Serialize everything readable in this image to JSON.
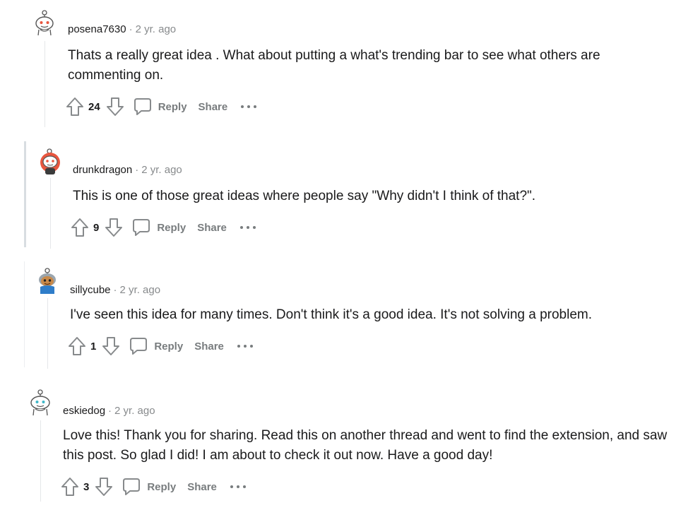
{
  "comments": [
    {
      "author": "posena7630",
      "separator": "·",
      "time": "2 yr. ago",
      "text": "Thats a really great idea . What about putting a what's trending bar to see what others are commenting on.",
      "votes": "24",
      "reply_label": "Reply",
      "share_label": "Share",
      "avatar_color": "#e8563f"
    },
    {
      "author": "drunkdragon",
      "separator": "·",
      "time": "2 yr. ago",
      "text": "This is one of those great ideas where people say \"Why didn't I think of that?\".",
      "votes": "9",
      "reply_label": "Reply",
      "share_label": "Share",
      "avatar_color": "#e8563f"
    },
    {
      "author": "sillycube",
      "separator": "·",
      "time": "2 yr. ago",
      "text": "I've seen this idea for many times. Don't think it's a good idea. It's not solving a problem.",
      "votes": "1",
      "reply_label": "Reply",
      "share_label": "Share",
      "avatar_color": "#2f7dc9"
    },
    {
      "author": "eskiedog",
      "separator": "·",
      "time": "2 yr. ago",
      "text": "Love this! Thank you for sharing. Read this on another thread and went to find the extension, and saw this post. So glad I did! I am about to check it out now. Have a good day!",
      "votes": "3",
      "reply_label": "Reply",
      "share_label": "Share",
      "avatar_color": "#3fb6c7"
    }
  ],
  "colors": {
    "text": "#1a1a1b",
    "muted": "#878a8c",
    "action": "#787c7e",
    "thread_line": "#e5e7e9"
  },
  "icons": {
    "upvote": "arrow-up-outline-icon",
    "downvote": "arrow-down-outline-icon",
    "reply": "speech-bubble-icon",
    "more": "ellipsis-icon"
  }
}
